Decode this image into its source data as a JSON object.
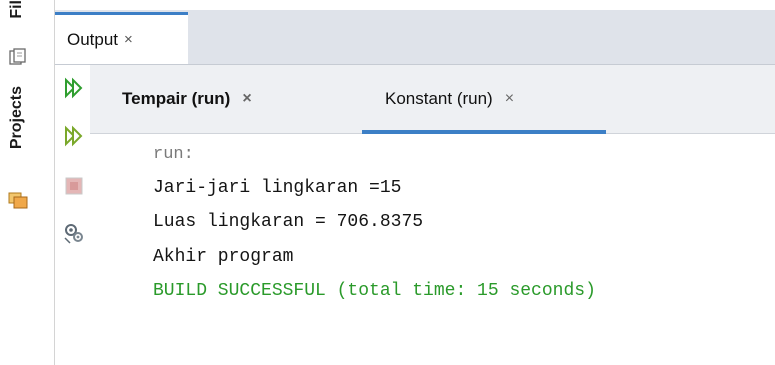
{
  "side": {
    "files_label": "Fil",
    "projects_label": "Projects"
  },
  "output_tab": {
    "label": "Output",
    "close": "×"
  },
  "toolbar": {
    "icons": [
      "rerun-icon",
      "rerun-alt-icon",
      "stop-icon",
      "settings-icon"
    ]
  },
  "tabs": [
    {
      "label": "Tempair (run)",
      "close": "×",
      "active": false
    },
    {
      "label": "Konstant (run)",
      "close": "×",
      "active": true
    }
  ],
  "console": {
    "run": "run:",
    "lines": [
      "Jari-jari lingkaran =15",
      "Luas lingkaran = 706.8375",
      "Akhir program"
    ],
    "build": "BUILD SUCCESSFUL (total time: 15 seconds)"
  },
  "colors": {
    "accent": "#3c7fc6",
    "build_success": "#2a9a2a",
    "run_gray": "#7a7a7a",
    "header_bg": "#dfe3ea"
  }
}
